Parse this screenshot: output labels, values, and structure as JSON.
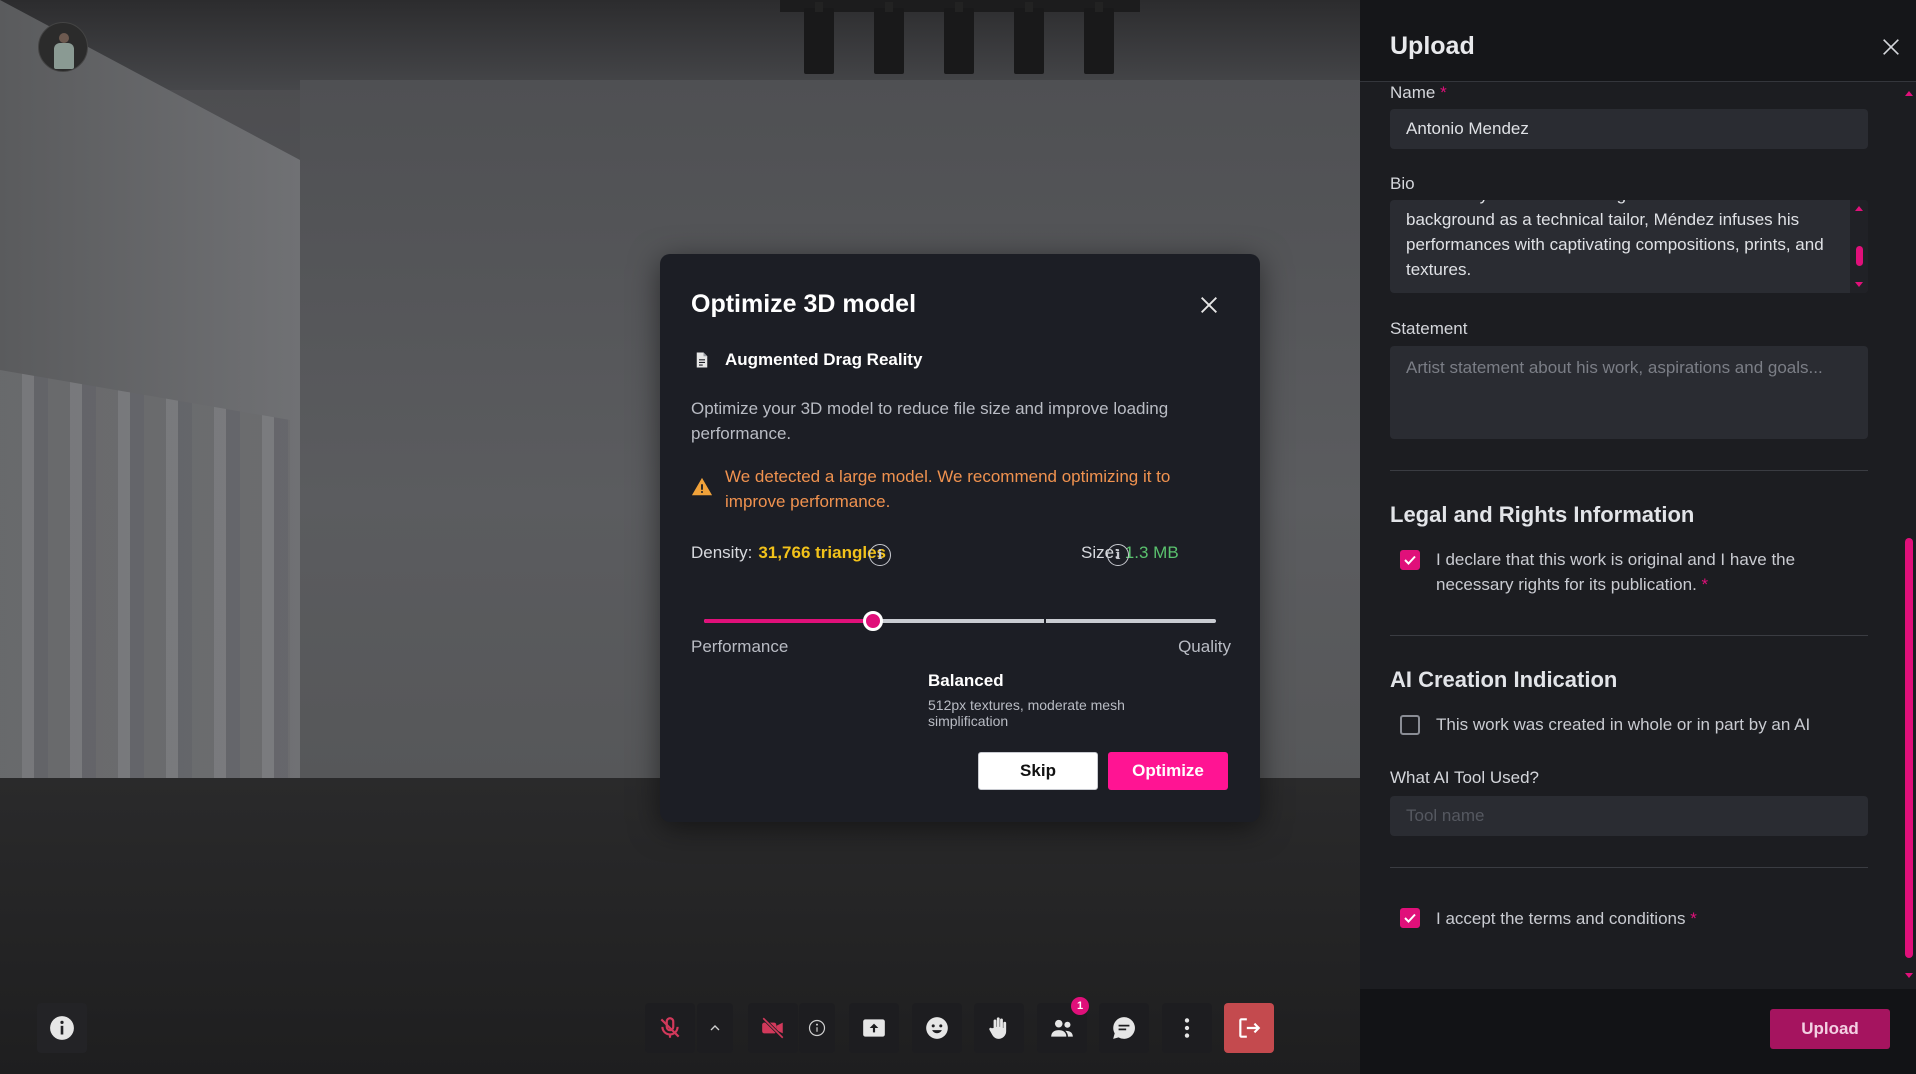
{
  "scene": {
    "icons": [
      "avatar",
      "spotlight"
    ]
  },
  "toolbar": {
    "leave_color": "#c44a4e",
    "participants_badge": "1",
    "icons": [
      "info-icon",
      "mic-off-icon",
      "chevron-up-icon",
      "camera-off-icon",
      "share-screen-icon",
      "emoji-icon",
      "raise-hand-icon",
      "participants-icon",
      "chat-icon",
      "more-icon",
      "leave-icon"
    ]
  },
  "modal": {
    "title": "Optimize 3D model",
    "file_name": "Augmented Drag Reality",
    "description": "Optimize your 3D model to reduce file size and improve loading performance.",
    "warning": "We detected a large model. We recommend optimizing it to improve performance.",
    "density_label": "Density:",
    "density_value": "31,766 triangles",
    "size_label": "Size:",
    "size_value": "1.3 MB",
    "slider_value_fraction": 0.33,
    "slider_left_label": "Performance",
    "slider_right_label": "Quality",
    "preset_name": "Balanced",
    "preset_description": "512px textures, moderate mesh simplification",
    "skip_label": "Skip",
    "optimize_label": "Optimize",
    "accent": "#ff1493",
    "warning_color": "#f0924f",
    "density_color": "#f2c21a",
    "size_color": "#5ac26e"
  },
  "panel": {
    "title": "Upload",
    "name_label": "Name",
    "required_mark": "*",
    "name_value": "Antonio Mendez",
    "bio_label": "Bio",
    "bio_value": "community activism. Drawing from an unconventional background as a technical tailor, Méndez infuses his performances with captivating compositions, prints, and textures.",
    "statement_label": "Statement",
    "statement_placeholder": "Artist statement about his work, aspirations and goals...",
    "legal_title": "Legal and Rights Information",
    "legal_check_label": "I declare that this work is original and I have the necessary rights for its publication.",
    "legal_checked": true,
    "ai_title": "AI Creation Indication",
    "ai_check_label": "This work was created in whole or in part by an AI",
    "ai_checked": false,
    "ai_tool_label": "What AI Tool Used?",
    "ai_tool_placeholder": "Tool name",
    "terms_label": "I accept the terms and conditions",
    "terms_checked": true,
    "upload_label": "Upload"
  }
}
